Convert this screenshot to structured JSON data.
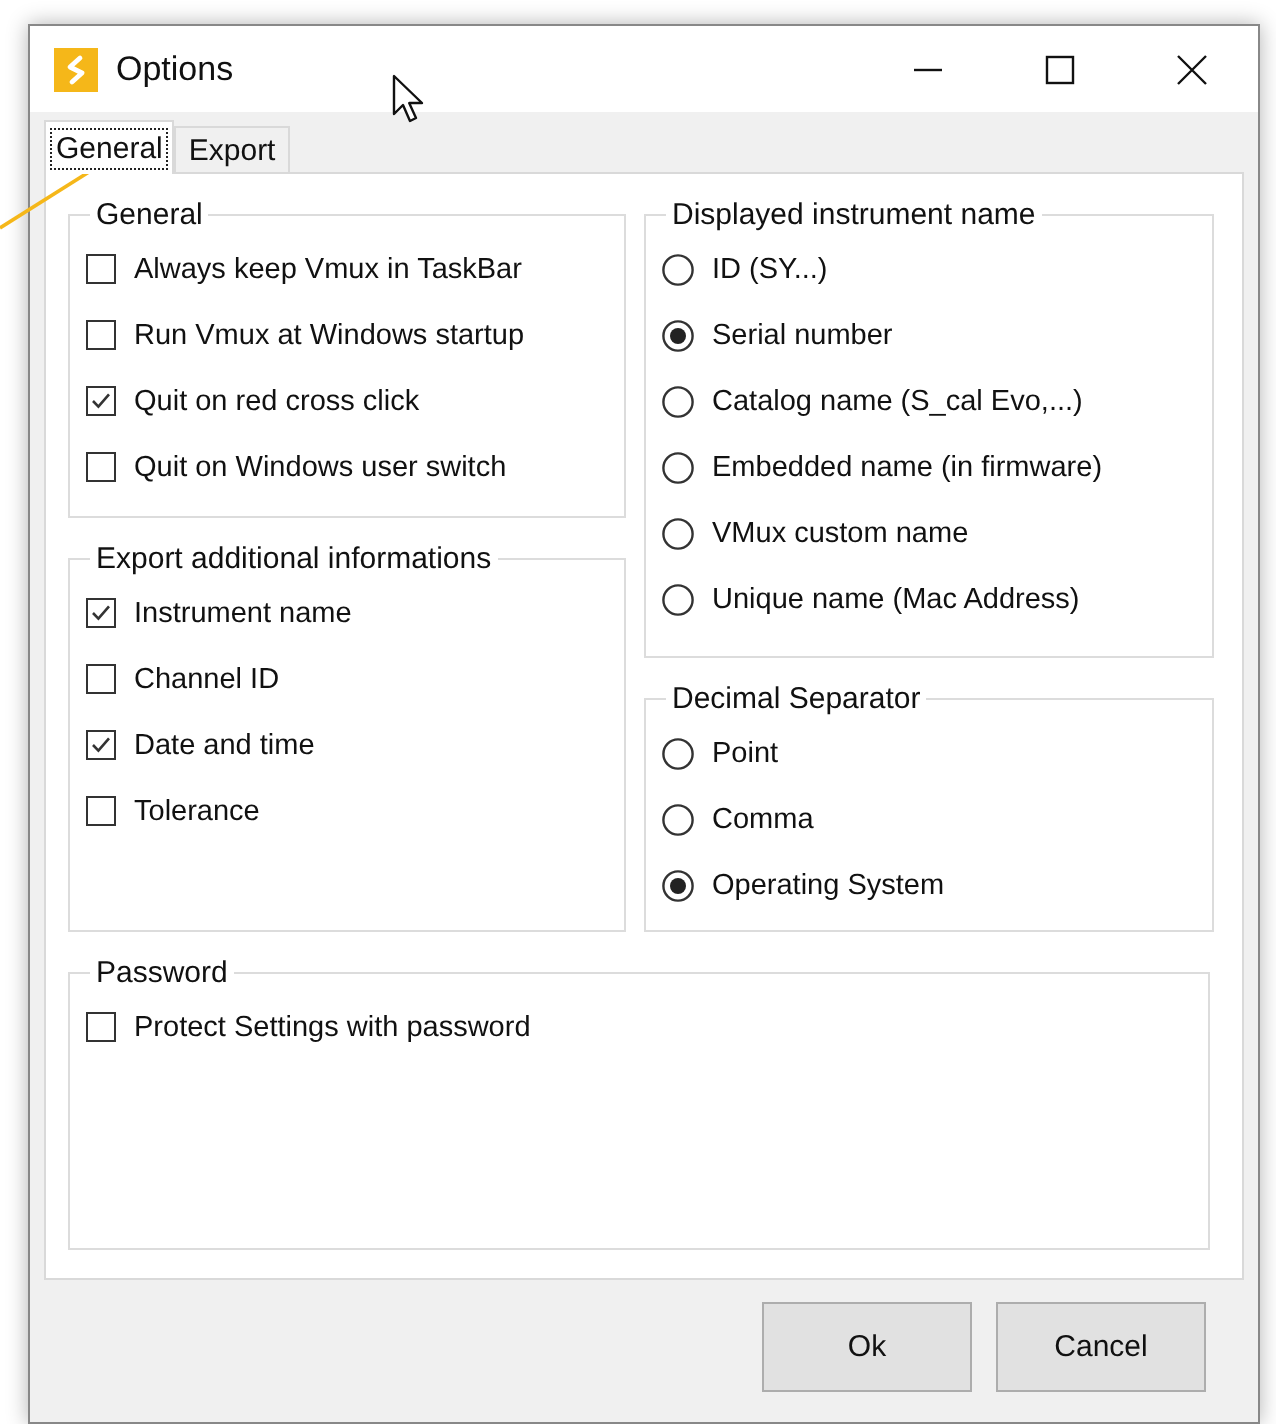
{
  "window": {
    "title": "Options"
  },
  "tabs": [
    {
      "label": "General",
      "selected": true
    },
    {
      "label": "Export",
      "selected": false
    }
  ],
  "columns": [
    [
      {
        "title": "General",
        "kind": "checks",
        "items": [
          {
            "label": "Always keep Vmux in TaskBar",
            "checked": false
          },
          {
            "label": "Run Vmux at Windows startup",
            "checked": false
          },
          {
            "label": "Quit on red cross click",
            "checked": true
          },
          {
            "label": "Quit on Windows user switch",
            "checked": false
          }
        ]
      },
      {
        "title": "Export additional informations",
        "kind": "checks",
        "items": [
          {
            "label": "Instrument name",
            "checked": true
          },
          {
            "label": "Channel ID",
            "checked": false
          },
          {
            "label": "Date and time",
            "checked": true
          },
          {
            "label": "Tolerance",
            "checked": false
          }
        ]
      }
    ],
    [
      {
        "title": "Displayed instrument name",
        "kind": "radios",
        "items": [
          {
            "label": "ID (SY...)",
            "selected": false
          },
          {
            "label": "Serial number",
            "selected": true
          },
          {
            "label": "Catalog name (S_cal Evo,...)",
            "selected": false
          },
          {
            "label": "Embedded name (in firmware)",
            "selected": false
          },
          {
            "label": "VMux custom name",
            "selected": false
          },
          {
            "label": "Unique name (Mac Address)",
            "selected": false
          }
        ]
      },
      {
        "title": "Decimal Separator",
        "kind": "radios",
        "items": [
          {
            "label": "Point",
            "selected": false
          },
          {
            "label": "Comma",
            "selected": false
          },
          {
            "label": "Operating System",
            "selected": true
          }
        ]
      }
    ]
  ],
  "password": {
    "title": "Password",
    "kind": "checks",
    "items": [
      {
        "label": "Protect Settings with password",
        "checked": false
      }
    ]
  },
  "buttons": [
    "Ok",
    "Cancel"
  ]
}
